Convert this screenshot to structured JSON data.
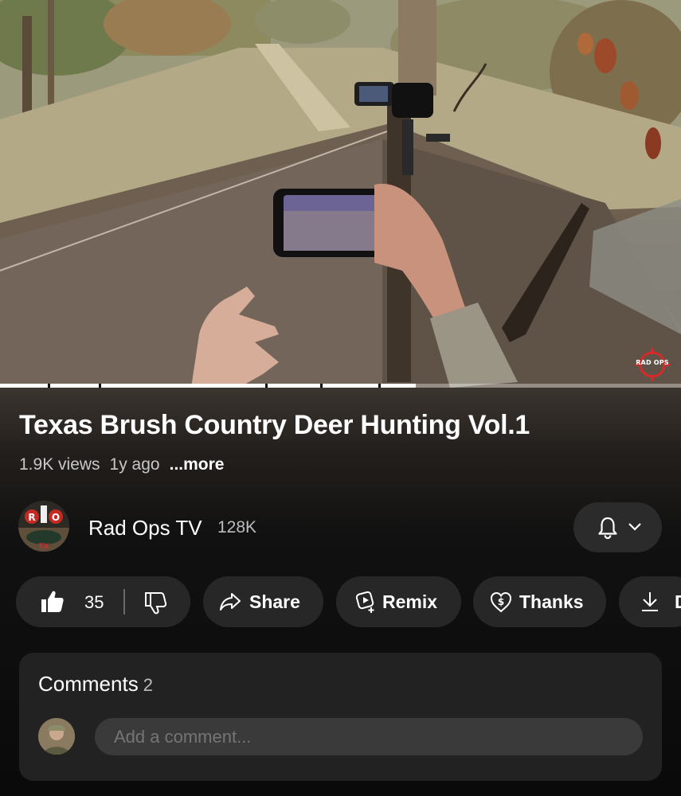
{
  "video": {
    "watermark_text": "RAD OPS",
    "progress": 0.61,
    "segment_markers": [
      0.07,
      0.145,
      0.39,
      0.47,
      0.555
    ]
  },
  "video_info": {
    "title": "Texas Brush Country Deer Hunting Vol.1",
    "views": "1.9K views",
    "age": "1y ago",
    "more_label": "...more"
  },
  "channel": {
    "name": "Rad Ops TV",
    "subscribers": "128K",
    "avatar_letters": [
      "R",
      "O"
    ],
    "avatar_badge": "TX"
  },
  "actions": {
    "like_count": "35",
    "share_label": "Share",
    "remix_label": "Remix",
    "thanks_label": "Thanks",
    "download_label": "D"
  },
  "comments": {
    "title": "Comments",
    "count": "2",
    "placeholder": "Add a comment..."
  },
  "icons": [
    "like-icon",
    "dislike-icon",
    "share-icon",
    "remix-icon",
    "thanks-icon",
    "download-icon",
    "bell-icon",
    "chevron-down-icon"
  ],
  "colors": {
    "background": "#0f0f0f",
    "pill": "#272727",
    "text": "#f1f1f1",
    "watermark": "#d62a2a"
  }
}
